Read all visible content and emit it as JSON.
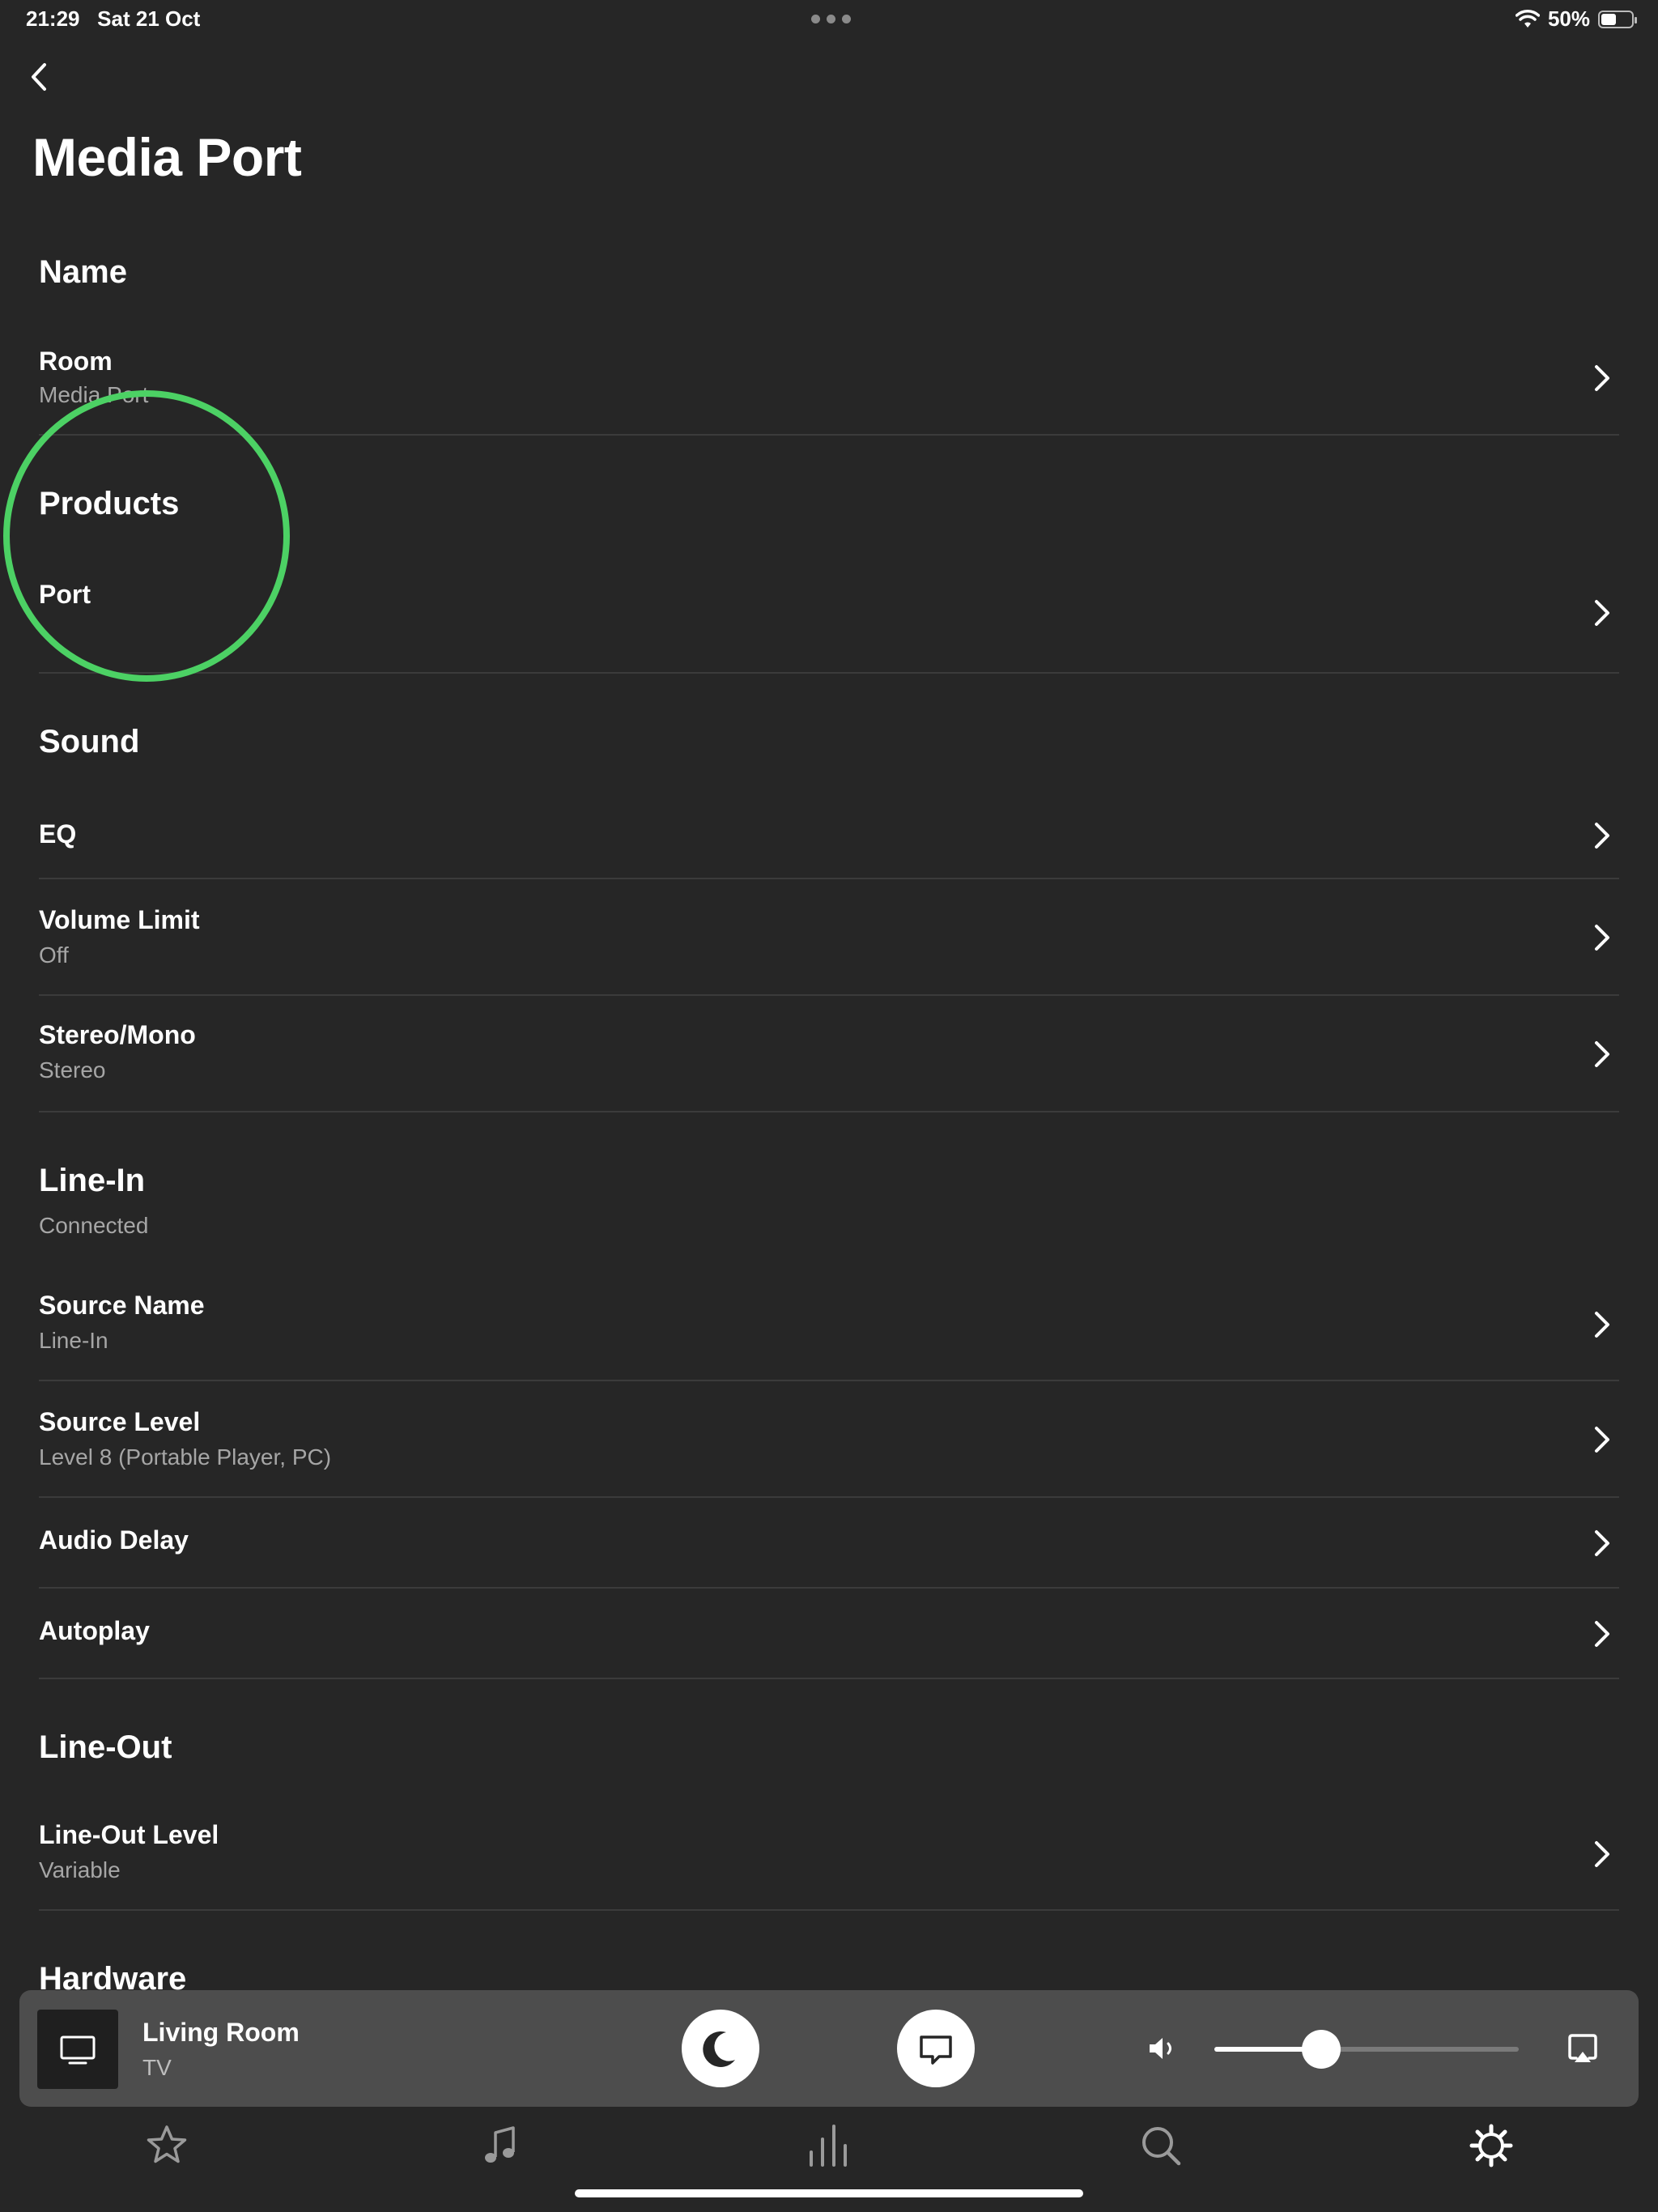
{
  "status_bar": {
    "time": "21:29",
    "date": "Sat 21 Oct",
    "battery": "50%",
    "battery_level": 0.5
  },
  "page": {
    "title": "Media Port"
  },
  "sections": {
    "name": {
      "header": "Name",
      "room": {
        "title": "Room",
        "value": "Media Port"
      }
    },
    "products": {
      "header": "Products",
      "port": {
        "title": "Port"
      }
    },
    "sound": {
      "header": "Sound",
      "eq": {
        "title": "EQ"
      },
      "volume_limit": {
        "title": "Volume Limit",
        "value": "Off"
      },
      "stereo_mono": {
        "title": "Stereo/Mono",
        "value": "Stereo"
      }
    },
    "line_in": {
      "header": "Line-In",
      "status": "Connected",
      "source_name": {
        "title": "Source Name",
        "value": "Line-In"
      },
      "source_level": {
        "title": "Source Level",
        "value": "Level 8 (Portable Player, PC)"
      },
      "audio_delay": {
        "title": "Audio Delay"
      },
      "autoplay": {
        "title": "Autoplay"
      }
    },
    "line_out": {
      "header": "Line-Out",
      "line_out_level": {
        "title": "Line-Out Level",
        "value": "Variable"
      }
    },
    "hardware": {
      "header": "Hardware"
    }
  },
  "player": {
    "room": "Living Room",
    "source": "TV",
    "volume": 0.35
  },
  "tabs": [
    {
      "name": "favorites",
      "icon": "star-icon"
    },
    {
      "name": "music",
      "icon": "music-note-icon"
    },
    {
      "name": "rooms",
      "icon": "equalizer-icon"
    },
    {
      "name": "search",
      "icon": "search-icon"
    },
    {
      "name": "settings",
      "icon": "gear-icon",
      "active": true
    }
  ],
  "colors": {
    "background": "#262626",
    "divider": "#3b3b3b",
    "secondary_text": "#a6a6a6",
    "highlight_circle": "#4cd164",
    "player_bar": "#4d4d4d"
  }
}
